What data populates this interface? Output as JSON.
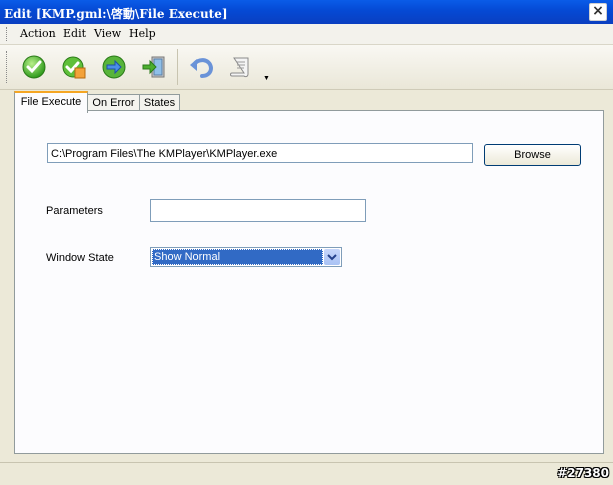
{
  "window": {
    "title": "Edit [KMP.gml:\\啓動\\File Execute]"
  },
  "menu": [
    "Action",
    "Edit",
    "View",
    "Help"
  ],
  "toolbar": {
    "buttons": [
      {
        "icon": "check-icon"
      },
      {
        "icon": "check-cube-icon"
      },
      {
        "icon": "forward-arrow-icon"
      },
      {
        "icon": "exit-door-icon"
      },
      {
        "icon": "undo-icon"
      },
      {
        "icon": "script-icon"
      }
    ]
  },
  "tabs": [
    "File Execute",
    "On Error",
    "States"
  ],
  "form": {
    "path_value": "C:\\Program Files\\The KMPlayer\\KMPlayer.exe",
    "browse_label": "Browse",
    "parameters_label": "Parameters",
    "parameters_value": "",
    "window_state_label": "Window State",
    "window_state_value": "Show Normal"
  },
  "watermark": "#27380",
  "colors": {
    "titlebar": "#0549d4",
    "selection": "#316ac5"
  }
}
